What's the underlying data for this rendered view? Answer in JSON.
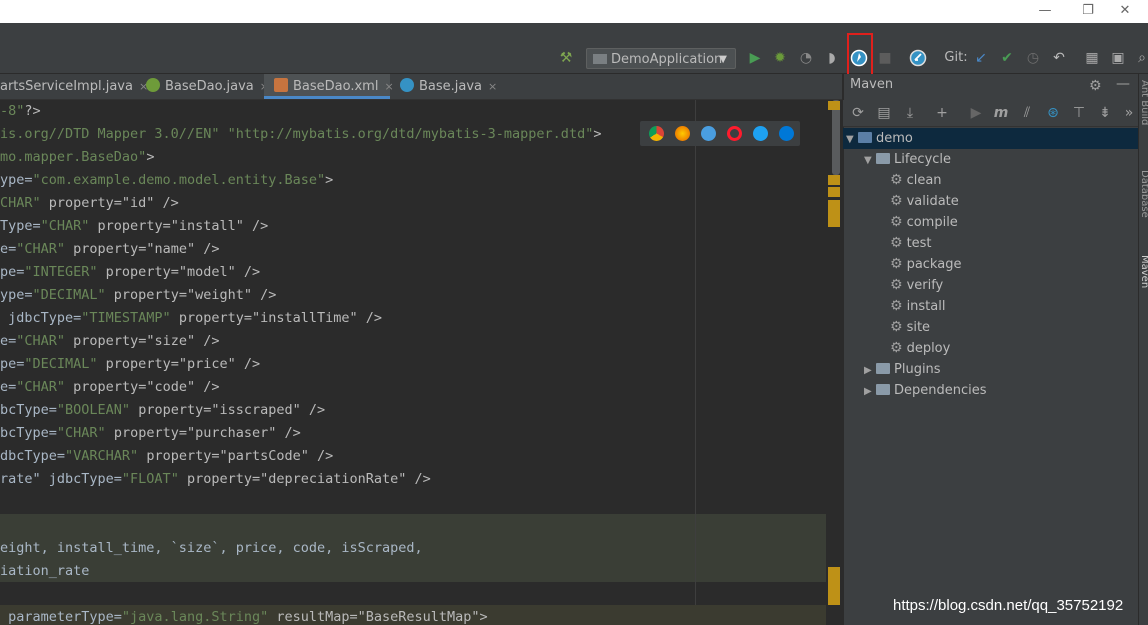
{
  "window": {
    "minimize": "—",
    "restore": "❐",
    "close": "✕"
  },
  "toolbar": {
    "run_config": "DemoApplication",
    "git_label": "Git:"
  },
  "tabs": [
    {
      "label": "artsServiceImpl.java"
    },
    {
      "label": "BaseDao.java"
    },
    {
      "label": "BaseDao.xml"
    },
    {
      "label": "Base.java"
    }
  ],
  "tab_close": "×",
  "editor": {
    "lines": [
      {
        "c": "",
        "s": "-8\"",
        "t": "?>"
      },
      {
        "c": "",
        "s": "is.org//DTD Mapper 3.0//EN\" \"http://mybatis.org/dtd/mybatis-3-mapper.dtd\"",
        "t": ">"
      },
      {
        "c": "",
        "s": "mo.mapper.BaseDao\"",
        "t": ">"
      },
      {
        "c": "ype=",
        "s": "\"com.example.demo.model.entity.Base\"",
        "t": ">"
      },
      {
        "c": "",
        "s": "CHAR\"",
        "t": " property=\"id\" />"
      },
      {
        "c": "Type=",
        "s": "\"CHAR\"",
        "t": " property=\"install\" />"
      },
      {
        "c": "e=",
        "s": "\"CHAR\"",
        "t": " property=\"name\" />"
      },
      {
        "c": "pe=",
        "s": "\"INTEGER\"",
        "t": " property=\"model\" />"
      },
      {
        "c": "ype=",
        "s": "\"DECIMAL\"",
        "t": " property=\"weight\" />"
      },
      {
        "c": " jdbcType=",
        "s": "\"TIMESTAMP\"",
        "t": " property=\"installTime\" />"
      },
      {
        "c": "e=",
        "s": "\"CHAR\"",
        "t": " property=\"size\" />"
      },
      {
        "c": "pe=",
        "s": "\"DECIMAL\"",
        "t": " property=\"price\" />"
      },
      {
        "c": "e=",
        "s": "\"CHAR\"",
        "t": " property=\"code\" />"
      },
      {
        "c": "bcType=",
        "s": "\"BOOLEAN\"",
        "t": " property=\"isscraped\" />"
      },
      {
        "c": "bcType=",
        "s": "\"CHAR\"",
        "t": " property=\"purchaser\" />"
      },
      {
        "c": "dbcType=",
        "s": "\"VARCHAR\"",
        "t": " property=\"partsCode\" />"
      },
      {
        "c": "rate\" jdbcType=",
        "s": "\"FLOAT\"",
        "t": " property=\"depreciationRate\" />"
      },
      {
        "c": "",
        "s": "",
        "t": ""
      },
      {
        "c": "",
        "s": "",
        "t": ""
      },
      {
        "c": "eight, install_time, `size`, price, code, isScraped,",
        "s": "",
        "t": ""
      },
      {
        "c": "iation_rate",
        "s": "",
        "t": ""
      },
      {
        "c": "",
        "s": "",
        "t": ""
      },
      {
        "c": " parameterType=",
        "s": "\"java.lang.String\"",
        "t": " resultMap=\"BaseResultMap\">"
      }
    ]
  },
  "maven": {
    "title": "Maven",
    "tree": [
      {
        "label": "demo",
        "level": 0,
        "kind": "project",
        "expanded": true
      },
      {
        "label": "Lifecycle",
        "level": 1,
        "kind": "folder",
        "expanded": true
      },
      {
        "label": "clean",
        "level": 2,
        "kind": "goal"
      },
      {
        "label": "validate",
        "level": 2,
        "kind": "goal"
      },
      {
        "label": "compile",
        "level": 2,
        "kind": "goal"
      },
      {
        "label": "test",
        "level": 2,
        "kind": "goal"
      },
      {
        "label": "package",
        "level": 2,
        "kind": "goal"
      },
      {
        "label": "verify",
        "level": 2,
        "kind": "goal"
      },
      {
        "label": "install",
        "level": 2,
        "kind": "goal"
      },
      {
        "label": "site",
        "level": 2,
        "kind": "goal"
      },
      {
        "label": "deploy",
        "level": 2,
        "kind": "goal"
      },
      {
        "label": "Plugins",
        "level": 1,
        "kind": "folder",
        "expanded": false
      },
      {
        "label": "Dependencies",
        "level": 1,
        "kind": "folder",
        "expanded": false
      }
    ]
  },
  "side_tabs": [
    "Ant Build",
    "Database",
    "Maven"
  ],
  "watermark": "https://blog.csdn.net/qq_35752192",
  "colors": {
    "accent": "#4a88c7",
    "highlight_box": "#e0201c",
    "run": "#499c54",
    "bug": "#6a9a3a"
  }
}
